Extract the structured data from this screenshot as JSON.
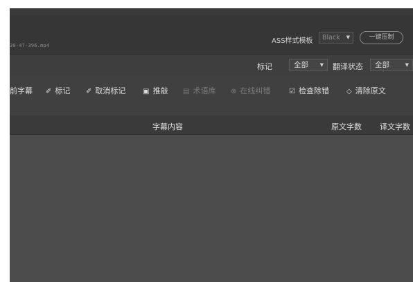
{
  "filebar": {
    "filename": "30-47-396.mp4",
    "ass_label": "ASS样式模板",
    "ass_value": "Black",
    "one_click_button": "一键压制"
  },
  "filters": {
    "mark_label": "标记",
    "mark_value": "全部",
    "translate_status_label": "翻译状态",
    "translate_status_value": "全部"
  },
  "toolbar": {
    "items": [
      {
        "label": "前字幕",
        "icon": "",
        "enabled": true
      },
      {
        "label": "标记",
        "icon": "✐",
        "enabled": true
      },
      {
        "label": "取消标记",
        "icon": "✐",
        "enabled": true
      },
      {
        "label": "推敲",
        "icon": "▣",
        "enabled": true
      },
      {
        "label": "术语库",
        "icon": "▤",
        "enabled": false
      },
      {
        "label": "在线纠错",
        "icon": "⊗",
        "enabled": false
      },
      {
        "label": "检查除错",
        "icon": "☑",
        "enabled": true
      },
      {
        "label": "清除原文",
        "icon": "◇",
        "enabled": true
      }
    ]
  },
  "table": {
    "columns": [
      "字幕内容",
      "原文字数",
      "译文字数"
    ]
  }
}
